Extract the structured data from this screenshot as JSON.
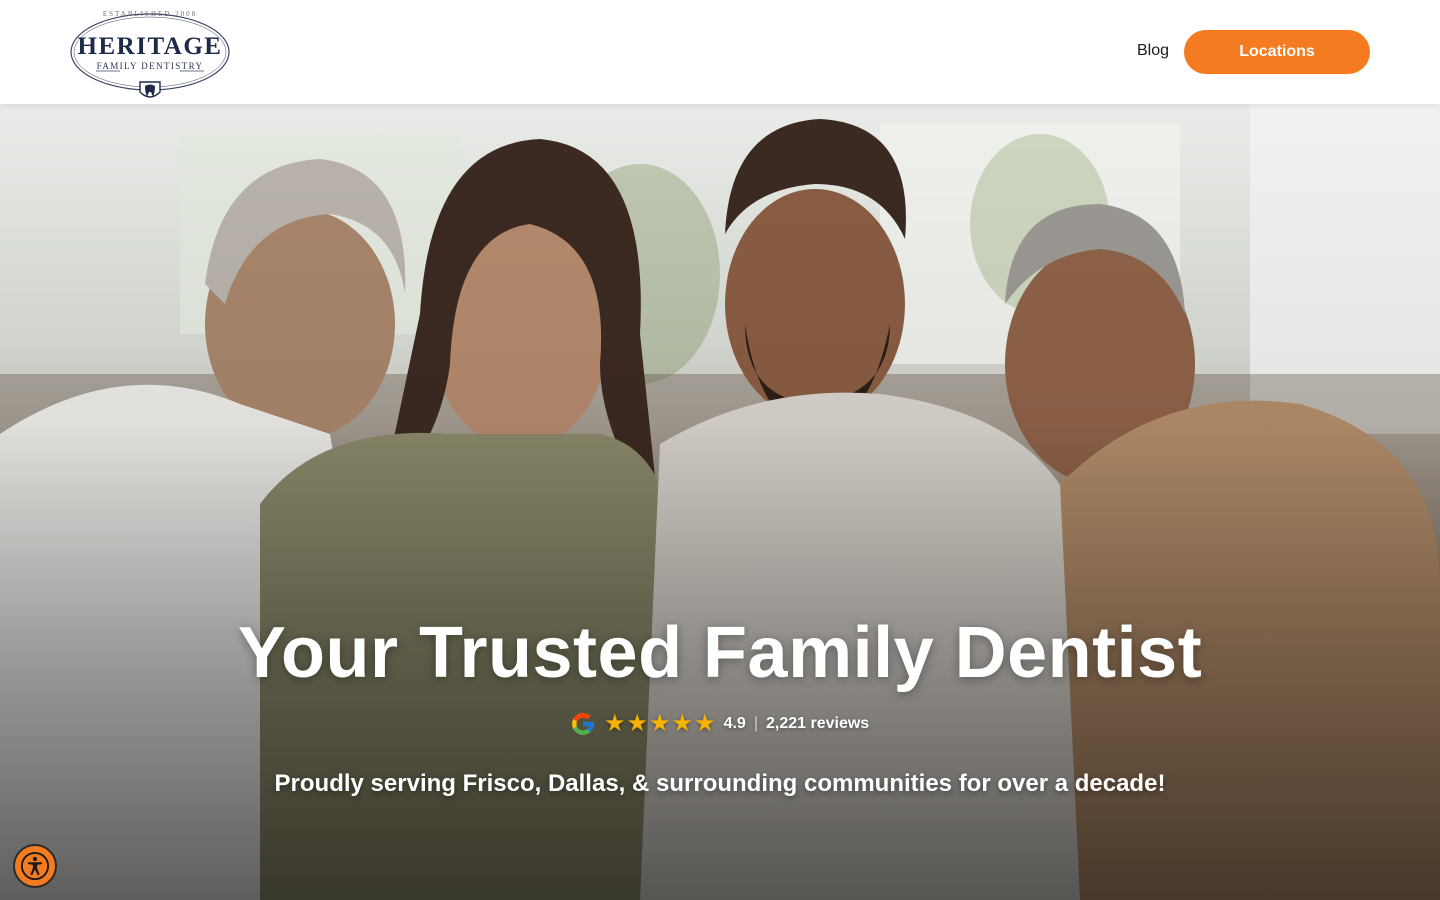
{
  "header": {
    "logo": {
      "established": "ESTABLISHED 2008",
      "name": "HERITAGE",
      "tagline": "FAMILY DENTISTRY"
    },
    "nav": {
      "blog_label": "Blog",
      "locations_label": "Locations"
    },
    "accent_color": "#f47b20"
  },
  "hero": {
    "title": "Your Trusted Family Dentist",
    "rating": {
      "source_icon": "google-icon",
      "stars": 5,
      "score": "4.9",
      "reviews": "2,221 reviews"
    },
    "subtitle": "Proudly serving Frisco, Dallas, & surrounding communities for over a decade!",
    "image": "family-photo"
  },
  "widgets": {
    "accessibility_icon": "accessibility-icon"
  }
}
